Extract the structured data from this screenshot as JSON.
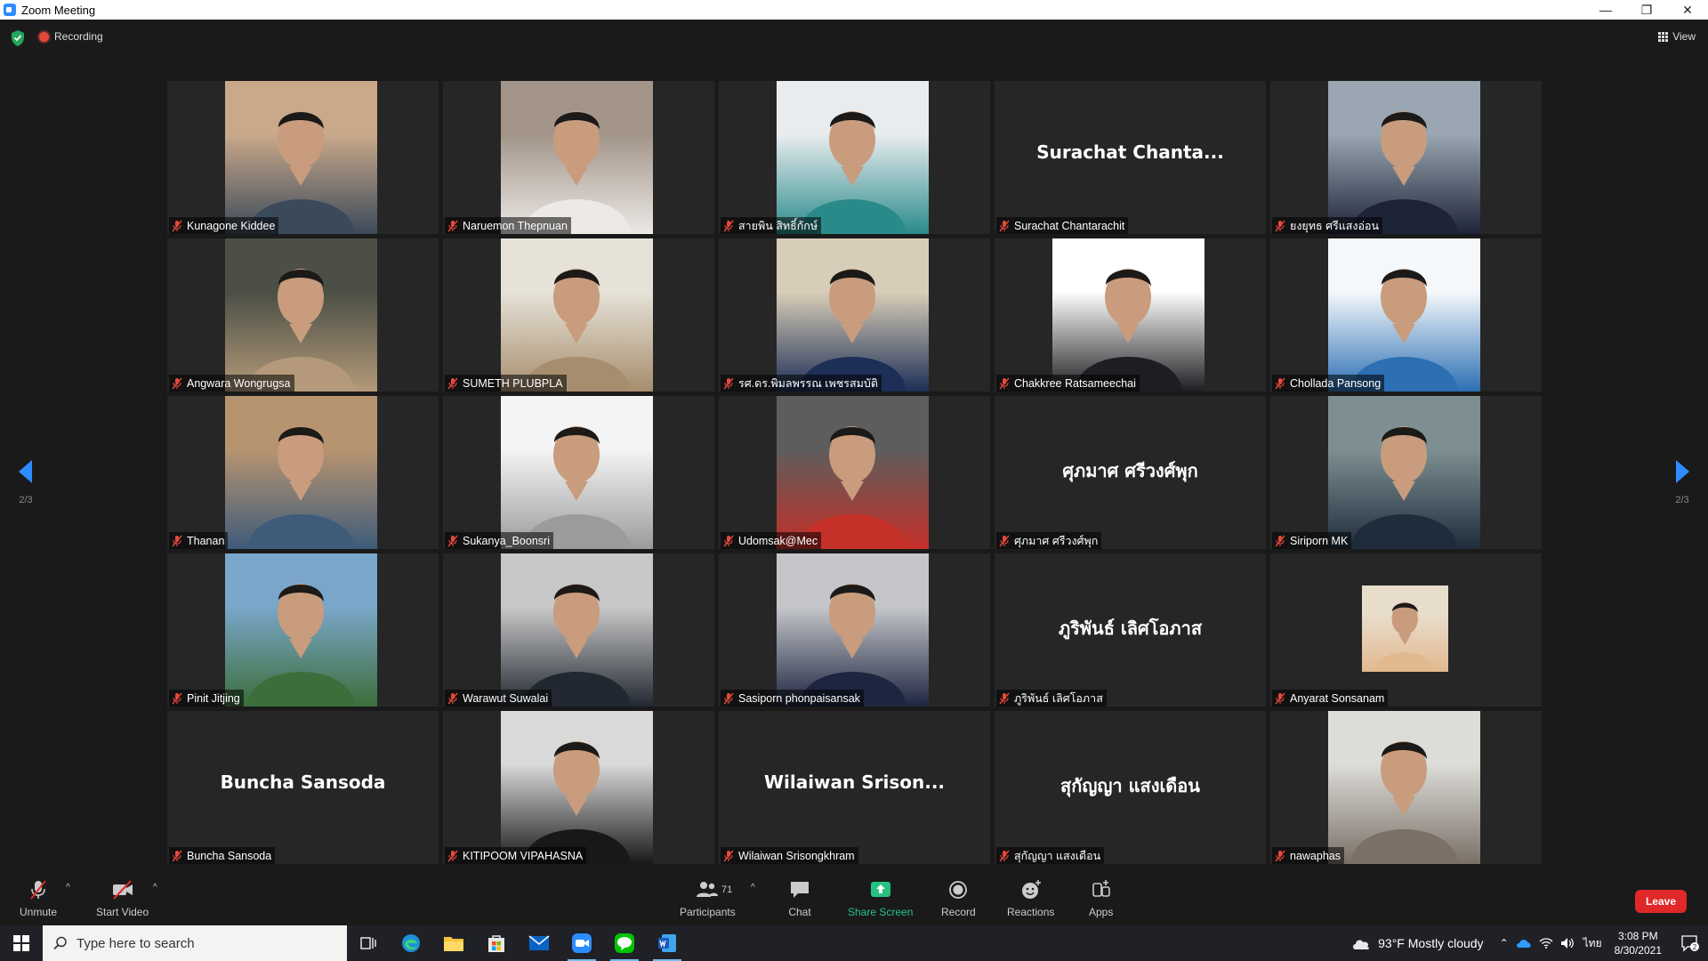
{
  "window": {
    "title": "Zoom Meeting"
  },
  "topbar": {
    "recording_label": "Recording",
    "view_label": "View"
  },
  "pagination": {
    "left_page": "2/3",
    "right_page": "2/3"
  },
  "participants": [
    {
      "name": "Kunagone Kiddee",
      "muted": true,
      "video": true,
      "bg": [
        "#c9a98a",
        "#3b4a5a"
      ]
    },
    {
      "name": "Naruemon Thepnuan",
      "muted": true,
      "video": true,
      "bg": [
        "#a3958a",
        "#ece9e6"
      ]
    },
    {
      "name": "สายพิน สิทธิ์กักษ์",
      "muted": true,
      "video": true,
      "bg": [
        "#e9ecef",
        "#2a8a8a"
      ]
    },
    {
      "name": "Surachat Chantarachit",
      "muted": true,
      "video": false,
      "big_name": "Surachat  Chanta..."
    },
    {
      "name": "ยงยุทธ ศรีแสงอ่อน",
      "muted": true,
      "video": true,
      "bg": [
        "#9aa6b2",
        "#1d2438"
      ]
    },
    {
      "name": "Angwara Wongrugsa",
      "muted": true,
      "video": true,
      "bg": [
        "#4b4f45",
        "#b49a7a"
      ]
    },
    {
      "name": "SUMETH PLUBPLA",
      "muted": true,
      "video": true,
      "bg": [
        "#e6e2d8",
        "#a68d6d"
      ]
    },
    {
      "name": "รศ.ดร.พิมลพรรณ เพชรสมบัติ",
      "muted": true,
      "video": true,
      "bg": [
        "#d8cdb8",
        "#1d2f56"
      ]
    },
    {
      "name": "Chakkree Ratsameechai",
      "muted": true,
      "video": true,
      "bg": [
        "#ffffff",
        "#1e1e22"
      ]
    },
    {
      "name": "Chollada Pansong",
      "muted": true,
      "video": true,
      "bg": [
        "#f4f8fb",
        "#2c6fb3"
      ]
    },
    {
      "name": "Thanan",
      "muted": true,
      "video": true,
      "bg": [
        "#b79470",
        "#3e5b7a"
      ]
    },
    {
      "name": "Sukanya_Boonsri",
      "muted": true,
      "video": true,
      "bg": [
        "#f4f4f4",
        "#9b9b9b"
      ]
    },
    {
      "name": "Udomsak@Mec",
      "muted": true,
      "video": true,
      "bg": [
        "#5d5d5d",
        "#c53028"
      ]
    },
    {
      "name": "ศุภมาศ ศรีวงศ์พุก",
      "muted": true,
      "video": false,
      "big_name": "ศุภมาศ ศรีวงศ์พุก"
    },
    {
      "name": "Siriporn MK",
      "muted": true,
      "video": true,
      "bg": [
        "#7e8f93",
        "#1f2c3b"
      ]
    },
    {
      "name": "Pinit Jitjing",
      "muted": true,
      "video": true,
      "bg": [
        "#7aa6c9",
        "#3b6e3a"
      ]
    },
    {
      "name": "Warawut Suwalai",
      "muted": true,
      "video": true,
      "bg": [
        "#c8c8c8",
        "#222831"
      ]
    },
    {
      "name": "Sasiporn phonpaisansak",
      "muted": true,
      "video": true,
      "bg": [
        "#c4c6ca",
        "#1e2540"
      ]
    },
    {
      "name": "ภูริพันธ์ เลิศโอภาส",
      "muted": true,
      "video": false,
      "big_name": "ภูริพันธ์ เลิศโอภาส"
    },
    {
      "name": "Anyarat Sonsanam",
      "muted": true,
      "video": true,
      "small": true,
      "bg": [
        "#e8dccb",
        "#e2b98e"
      ]
    },
    {
      "name": "Buncha Sansoda",
      "muted": true,
      "video": false,
      "big_name": "Buncha Sansoda"
    },
    {
      "name": "KITIPOOM VIPAHASNA",
      "muted": true,
      "video": true,
      "bg": [
        "#d9d9d9",
        "#181818"
      ]
    },
    {
      "name": "Wilaiwan Srisongkhram",
      "muted": true,
      "video": false,
      "big_name": "Wilaiwan  Srison..."
    },
    {
      "name": "สุกัญญา แสงเดือน",
      "muted": true,
      "video": false,
      "big_name": "สุกัญญา  แสงเดือน"
    },
    {
      "name": "nawaphas",
      "muted": true,
      "video": true,
      "bg": [
        "#dcdcd8",
        "#7a7066"
      ]
    }
  ],
  "toolbar": {
    "unmute_label": "Unmute",
    "start_video_label": "Start Video",
    "participants_label": "Participants",
    "participants_count": "71",
    "chat_label": "Chat",
    "share_screen_label": "Share Screen",
    "record_label": "Record",
    "reactions_label": "Reactions",
    "apps_label": "Apps",
    "leave_label": "Leave"
  },
  "taskbar": {
    "search_placeholder": "Type here to search",
    "weather": "93°F  Mostly cloudy",
    "language": "ไทย",
    "time": "3:08 PM",
    "date": "8/30/2021",
    "notification_count": "2"
  },
  "colors": {
    "share_green": "#26c281",
    "leave_red": "#e02828",
    "zoom_blue": "#2D8CFF"
  }
}
